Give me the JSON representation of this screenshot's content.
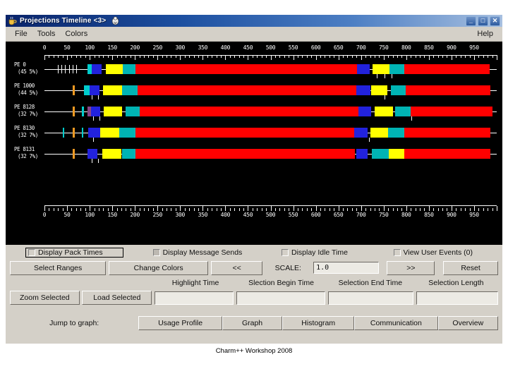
{
  "window": {
    "title": "Projections Timeline <3>",
    "icon": "coffee-cup-icon",
    "badge_icon": "java-duke-icon",
    "minimize_label": "_",
    "maximize_label": "□",
    "close_label": "✕"
  },
  "menubar": {
    "items": [
      {
        "label": "File",
        "name": "menu-file"
      },
      {
        "label": "Tools",
        "name": "menu-tools"
      },
      {
        "label": "Colors",
        "name": "menu-colors"
      }
    ],
    "help_label": "Help"
  },
  "timeline": {
    "axis_ticks": [
      "0",
      "50",
      "100",
      "150",
      "200",
      "250",
      "300",
      "350",
      "400",
      "450",
      "500",
      "550",
      "600",
      "650",
      "700",
      "750",
      "800",
      "850",
      "900",
      "950"
    ],
    "axis_min": 0,
    "axis_max": 1000,
    "colors": {
      "background": "#000000",
      "idle": "#ff0000",
      "blue_entry": "#2222dd",
      "yellow_entry": "#ffff00",
      "cyan_entry": "#00cccc",
      "orange_entry": "#ee9922",
      "teal_entry": "#00b4b4",
      "purple_entry": "#884488",
      "axis": "#ffffff"
    },
    "rows": [
      {
        "pe": "PE 0",
        "pct": "(45 5%)"
      },
      {
        "pe": "PE 1000",
        "pct": "(44 5%)"
      },
      {
        "pe": "PE 8128",
        "pct": "(32 7%)"
      },
      {
        "pe": "PE 8130",
        "pct": "(32 7%)"
      },
      {
        "pe": "PE 8131",
        "pct": "(32 7%)"
      }
    ]
  },
  "controls": {
    "checkboxes": [
      {
        "label": "Display Pack Times",
        "checked": false,
        "focused": true
      },
      {
        "label": "Display Message Sends",
        "checked": false,
        "focused": false
      },
      {
        "label": "Display Idle Time",
        "checked": false,
        "focused": false
      },
      {
        "label": "View User Events (0)",
        "checked": false,
        "focused": false
      }
    ],
    "select_ranges_label": "Select Ranges",
    "change_colors_label": "Change Colors",
    "prev_label": "<<",
    "scale_label": "SCALE:",
    "scale_value": "1.0",
    "next_label": ">>",
    "reset_label": "Reset",
    "zoom_selected_label": "Zoom Selected",
    "load_selected_label": "Load Selected",
    "highlight_time_label": "Highlight Time",
    "highlight_time_value": "",
    "selection_begin_label": "Slection Begin Time",
    "selection_begin_value": "",
    "selection_end_label": "Selection End Time",
    "selection_end_value": "",
    "selection_length_label": "Selection Length",
    "selection_length_value": "",
    "jump_to_graph_label": "Jump to graph:",
    "jump_buttons": [
      {
        "label": "Usage Profile"
      },
      {
        "label": "Graph"
      },
      {
        "label": "Histogram"
      },
      {
        "label": "Communication"
      },
      {
        "label": "Overview"
      }
    ]
  },
  "footer": {
    "caption": "Charm++ Workshop 2008"
  }
}
